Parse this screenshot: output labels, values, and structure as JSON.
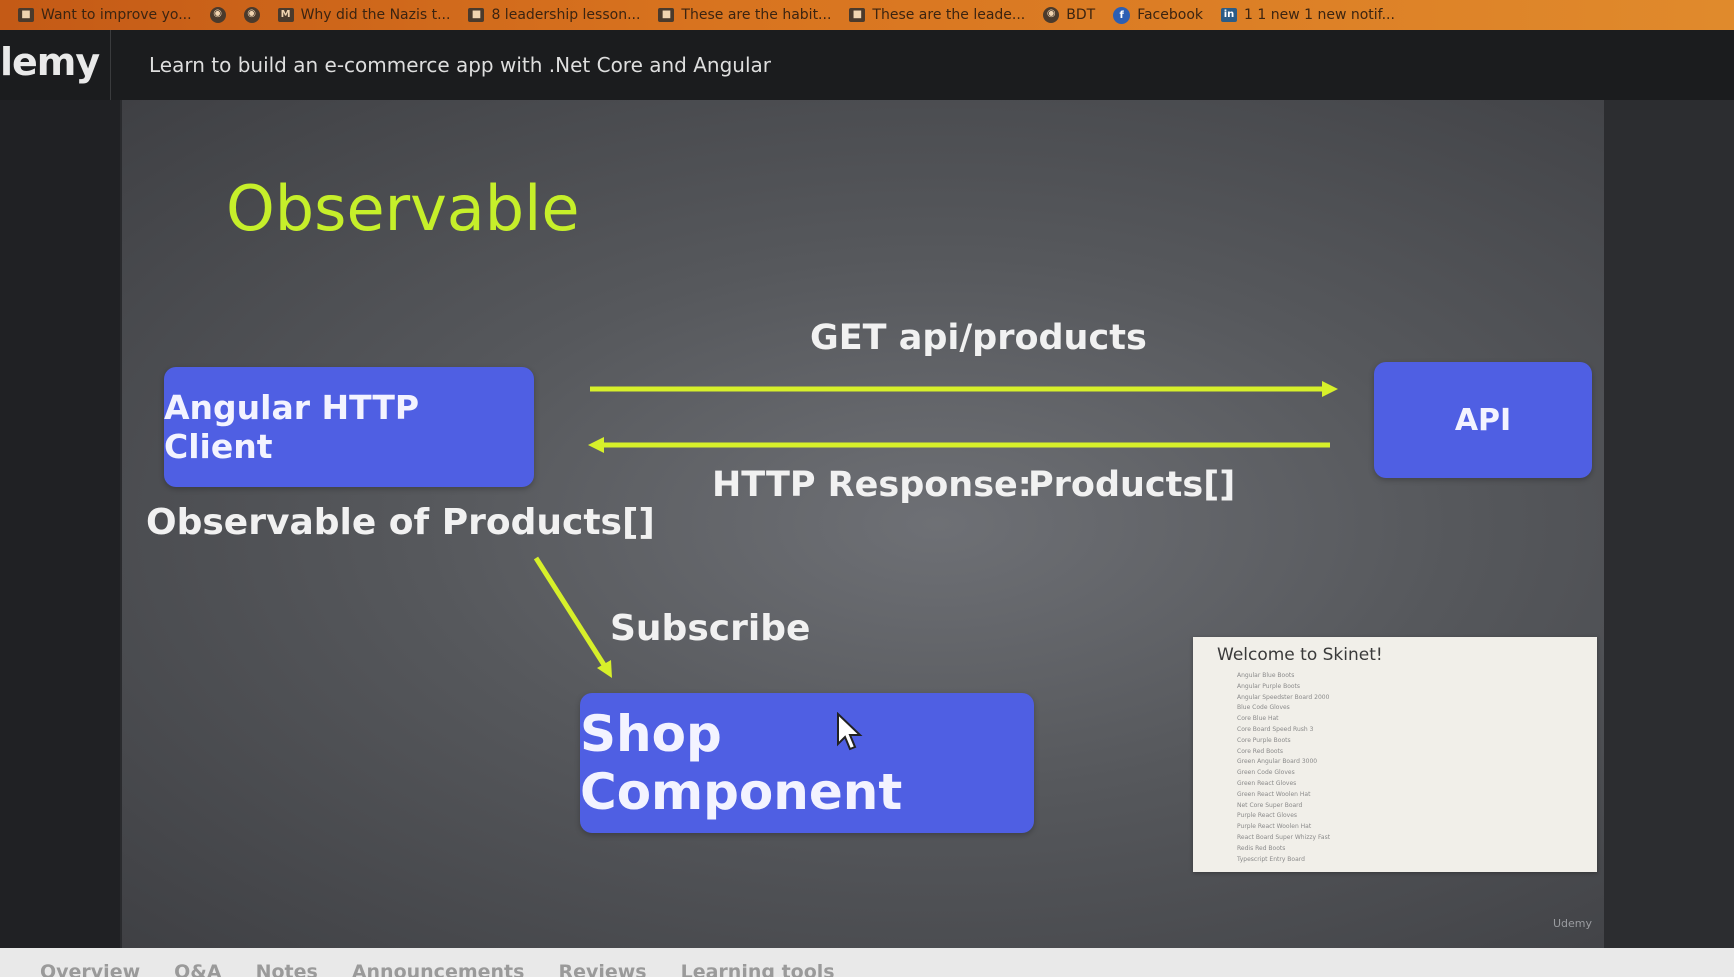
{
  "bookmarks": [
    {
      "icon": "page-icon",
      "label": "Want to improve yo..."
    },
    {
      "icon": "globe-icon",
      "label": ""
    },
    {
      "icon": "globe-icon",
      "label": ""
    },
    {
      "icon": "medium-icon",
      "label": "Why did the Nazis t..."
    },
    {
      "icon": "page-icon",
      "label": "8 leadership lesson..."
    },
    {
      "icon": "page-icon",
      "label": "These are the habit..."
    },
    {
      "icon": "page-icon",
      "label": "These are the leade..."
    },
    {
      "icon": "globe-icon",
      "label": "BDT"
    },
    {
      "icon": "facebook-icon",
      "label": "Facebook"
    },
    {
      "icon": "linkedin-icon",
      "label": "1 1 new 1 new notif..."
    }
  ],
  "header": {
    "logo": "lemy",
    "course_title": "Learn to build an e-commerce app with .Net Core and Angular"
  },
  "slide": {
    "title": "Observable",
    "http_client": "Angular HTTP Client",
    "api": "API",
    "shop_component": "Shop Component",
    "get_label": "GET api/products",
    "response_label": "HTTP Response:",
    "response_value": "Products[]",
    "observable_label": "Observable of Products[]",
    "subscribe_label": "Subscribe",
    "watermark": "Udemy",
    "accent_color": "#c6ef2a",
    "box_color": "#4f5fe3"
  },
  "preview": {
    "title": "Welcome to Skinet!",
    "items": [
      "Angular Blue Boots",
      "Angular Purple Boots",
      "Angular Speedster Board 2000",
      "Blue Code Gloves",
      "Core Blue Hat",
      "Core Board Speed Rush 3",
      "Core Purple Boots",
      "Core Red Boots",
      "Green Angular Board 3000",
      "Green Code Gloves",
      "Green React Gloves",
      "Green React Woolen Hat",
      "Net Core Super Board",
      "Purple React Gloves",
      "Purple React Woolen Hat",
      "React Board Super Whizzy Fast",
      "Redis Red Boots",
      "Typescript Entry Board"
    ]
  },
  "tabs": [
    "Overview",
    "Q&A",
    "Notes",
    "Announcements",
    "Reviews",
    "Learning tools"
  ]
}
